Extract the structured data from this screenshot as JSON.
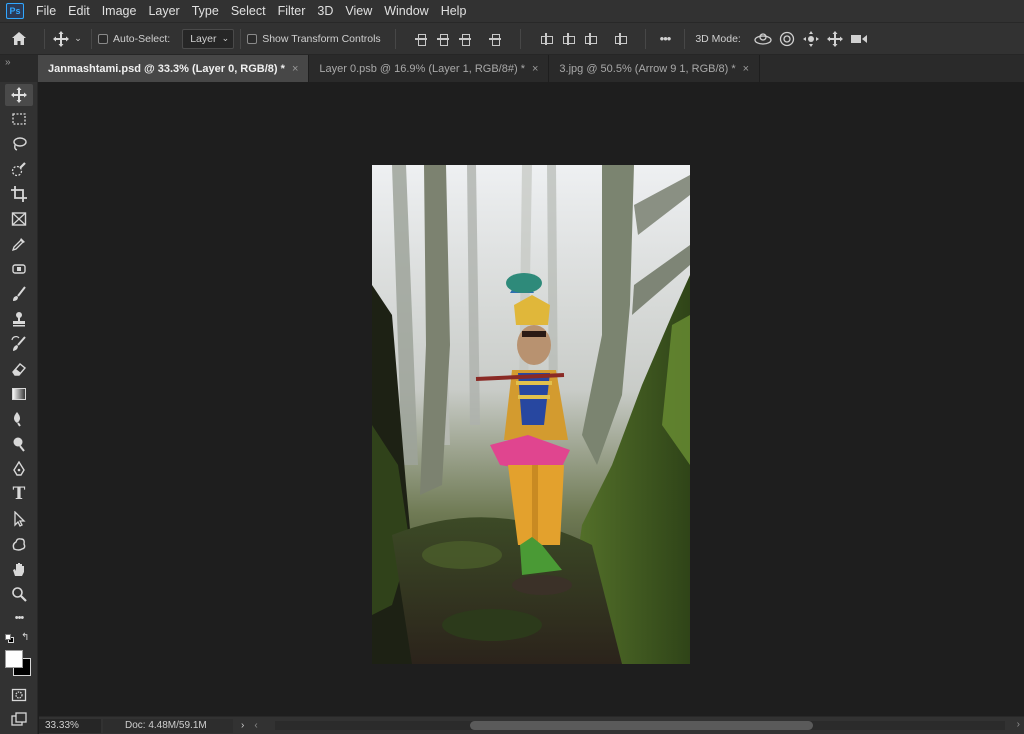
{
  "app": {
    "logo": "Ps"
  },
  "menu": [
    "File",
    "Edit",
    "Image",
    "Layer",
    "Type",
    "Select",
    "Filter",
    "3D",
    "View",
    "Window",
    "Help"
  ],
  "options_bar": {
    "auto_select_label": "Auto-Select:",
    "auto_select_target": "Layer",
    "show_transform_label": "Show Transform Controls",
    "more": "•••",
    "mode_3d_label": "3D Mode:"
  },
  "panel_collapse": "»",
  "tabs": [
    {
      "title": "Janmashtami.psd @ 33.3% (Layer 0, RGB/8) *",
      "close": "×",
      "active": true
    },
    {
      "title": "Layer 0.psb @ 16.9% (Layer 1, RGB/8#) *",
      "close": "×",
      "active": false
    },
    {
      "title": "3.jpg @ 50.5% (Arrow 9 1, RGB/8) *",
      "close": "×",
      "active": false
    }
  ],
  "toolbar": {
    "collapse": "»",
    "text_tool_glyph": "T",
    "more_glyph": "•••",
    "foreground_color": "#ffffff",
    "background_color": "#000000"
  },
  "status": {
    "zoom": "33.33%",
    "doc": "Doc: 4.48M/59.1M",
    "arrow": "›",
    "scroll_left": "‹",
    "scroll_right": "›"
  },
  "colors": {
    "app_bg": "#323232",
    "canvas_bg": "#1e1e1e",
    "accent": "#31a8ff"
  }
}
